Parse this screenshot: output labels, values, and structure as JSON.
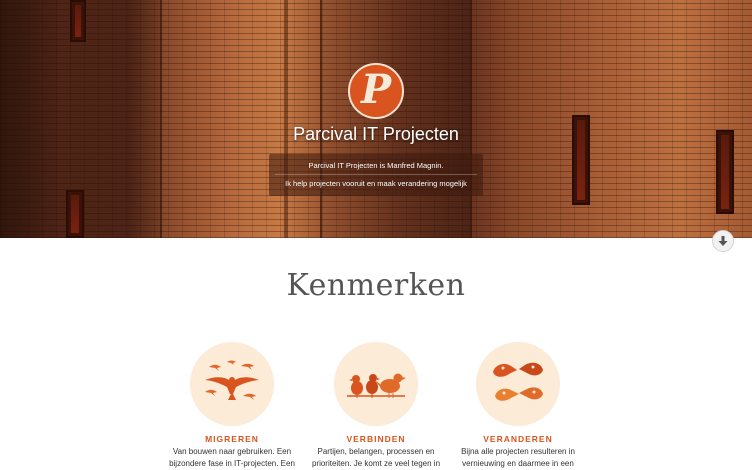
{
  "hero": {
    "logo_letter": "P",
    "title": "Parcival IT Projecten",
    "tagline_line1": "Parcival IT Projecten is Manfred Magnin.",
    "tagline_line2": "Ik help projecten vooruit en maak verandering mogelijk"
  },
  "section": {
    "title": "Kenmerken"
  },
  "features": [
    {
      "title": "MIGREREN",
      "text_line1": "Van bouwen naar gebruiken. Een",
      "text_line2": "bijzondere fase in IT-projecten. Een",
      "icon": "migrating-birds-icon"
    },
    {
      "title": "VERBINDEN",
      "text_line1": "Partijen, belangen, processen en",
      "text_line2": "prioriteiten. Je komt ze veel tegen in",
      "icon": "birds-on-wire-icon"
    },
    {
      "title": "VERANDEREN",
      "text_line1": "Bijna alle projecten resulteren in",
      "text_line2": "vernieuwing en daarmee in een",
      "icon": "bird-heads-icon"
    }
  ],
  "colors": {
    "accent": "#d9541e",
    "circle_bg": "#fcebd6",
    "heading": "#555555"
  }
}
